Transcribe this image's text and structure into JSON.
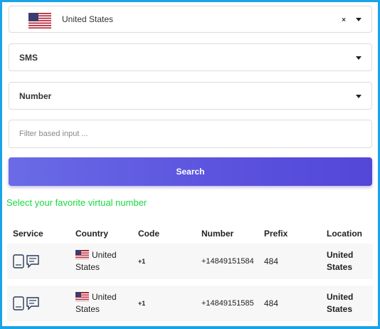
{
  "filters": {
    "country": {
      "value": "United States",
      "flag_icon": "us-flag-icon",
      "clear_label": "×"
    },
    "service": {
      "value": "SMS"
    },
    "type": {
      "value": "Number"
    },
    "search": {
      "placeholder": "Filter based input ..."
    }
  },
  "search_button": {
    "label": "Search"
  },
  "hint": "Select your favorite virtual number",
  "table": {
    "headers": [
      "Service",
      "Country",
      "Code",
      "Number",
      "Prefix",
      "Location"
    ],
    "rows": [
      {
        "country": "United States",
        "code": "+1",
        "number": "+14849151584",
        "prefix": "484",
        "location": "United States"
      },
      {
        "country": "United States",
        "code": "+1",
        "number": "+14849151585",
        "prefix": "484",
        "location": "United States"
      }
    ]
  },
  "colors": {
    "accent": "#5b52de",
    "frame": "#1ba3e8",
    "hint": "#17d93f"
  }
}
